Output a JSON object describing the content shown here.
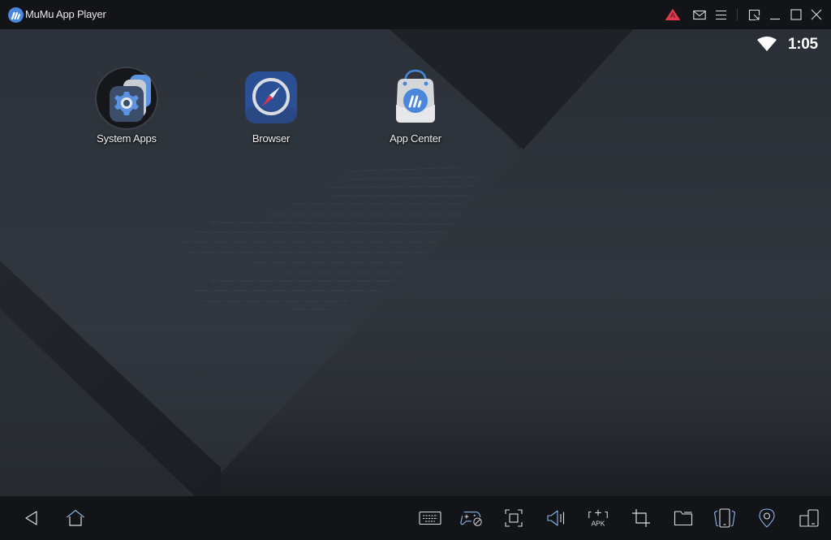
{
  "window": {
    "title": "MuMu App Player",
    "titlebar_icons": [
      {
        "name": "alert-icon",
        "color": "#e03a4e"
      },
      {
        "name": "mail-icon"
      },
      {
        "name": "menu-icon"
      },
      {
        "name": "shrink-window-icon"
      },
      {
        "name": "minimize-icon"
      },
      {
        "name": "maximize-icon"
      },
      {
        "name": "close-icon"
      }
    ]
  },
  "statusbar": {
    "wifi": "wifi-icon",
    "time": "1:05"
  },
  "home_screen": {
    "apps": [
      {
        "label": "System Apps",
        "icon": "system-apps-icon"
      },
      {
        "label": "Browser",
        "icon": "browser-compass-icon"
      },
      {
        "label": "App Center",
        "icon": "app-center-bag-icon"
      }
    ]
  },
  "navigation": {
    "left": [
      {
        "name": "back-icon"
      },
      {
        "name": "home-icon"
      }
    ],
    "tools": [
      {
        "name": "keyboard-icon"
      },
      {
        "name": "gamepad-mapping-icon"
      },
      {
        "name": "fullscreen-icon"
      },
      {
        "name": "volume-icon"
      },
      {
        "name": "install-apk-icon",
        "text": "APK"
      },
      {
        "name": "crop-screenshot-icon"
      },
      {
        "name": "folder-icon"
      },
      {
        "name": "rotate-device-icon"
      },
      {
        "name": "location-icon"
      },
      {
        "name": "multi-instance-icon"
      }
    ]
  },
  "colors": {
    "accent_blue": "#4a86d9",
    "alert_red": "#e03a4e",
    "chrome_bg": "#131417",
    "icon_stroke": "#d8dce4"
  }
}
